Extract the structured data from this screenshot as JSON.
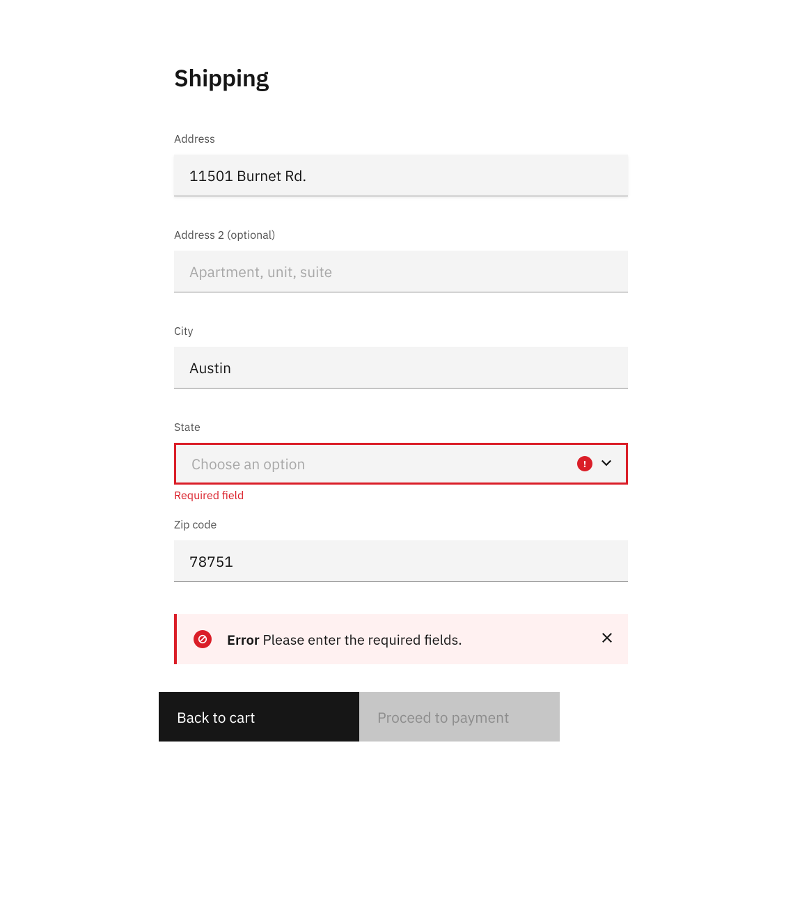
{
  "title": "Shipping",
  "fields": {
    "address": {
      "label": "Address",
      "value": "11501 Burnet Rd."
    },
    "address2": {
      "label": "Address 2 (optional)",
      "value": "",
      "placeholder": "Apartment, unit, suite"
    },
    "city": {
      "label": "City",
      "value": "Austin"
    },
    "state": {
      "label": "State",
      "value": "",
      "placeholder": "Choose an option",
      "error": "Required field"
    },
    "zip": {
      "label": "Zip code",
      "value": "78751"
    }
  },
  "notification": {
    "title": "Error",
    "body": "Please enter the required fields."
  },
  "buttons": {
    "back": "Back to cart",
    "next": "Proceed to payment"
  },
  "colors": {
    "error": "#da1e28",
    "fieldBg": "#f4f4f4",
    "notificationBg": "#fff1f1"
  }
}
